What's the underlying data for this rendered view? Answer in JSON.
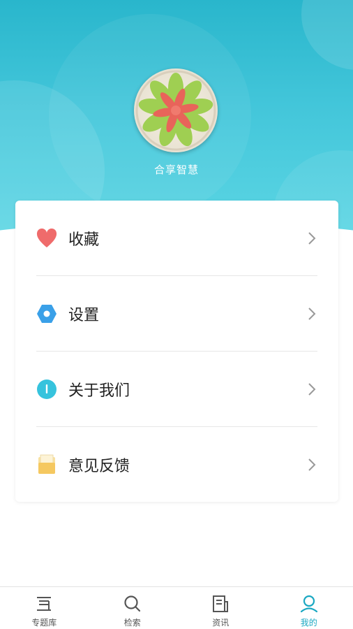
{
  "profile": {
    "username": "合享智慧"
  },
  "menu": {
    "items": [
      {
        "label": "收藏",
        "icon": "heart-icon",
        "color": "#ef6b6b"
      },
      {
        "label": "设置",
        "icon": "settings-hexagon-icon",
        "color": "#3aa0e8"
      },
      {
        "label": "关于我们",
        "icon": "info-icon",
        "color": "#36c3dd"
      },
      {
        "label": "意见反馈",
        "icon": "feedback-folder-icon",
        "color": "#f5c860"
      }
    ]
  },
  "tabbar": {
    "tabs": [
      {
        "label": "专题库",
        "icon": "topic-library-icon",
        "active": false
      },
      {
        "label": "检索",
        "icon": "search-icon",
        "active": false
      },
      {
        "label": "资讯",
        "icon": "news-icon",
        "active": false
      },
      {
        "label": "我的",
        "icon": "profile-icon",
        "active": true
      }
    ]
  },
  "colors": {
    "accent": "#1aa8c2",
    "header_top": "#29b6cc",
    "header_bottom": "#5cd6e4"
  }
}
